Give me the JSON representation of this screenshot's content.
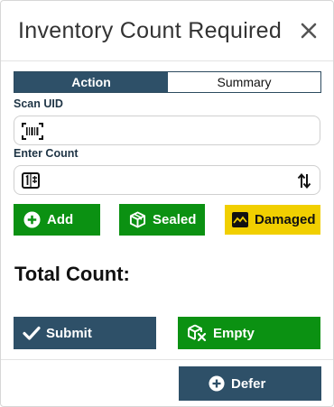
{
  "dialog": {
    "title": "Inventory Count Required"
  },
  "tabs": [
    {
      "label": "Action",
      "active": true
    },
    {
      "label": "Summary",
      "active": false
    }
  ],
  "scan_uid": {
    "label": "Scan UID",
    "value": ""
  },
  "enter_count": {
    "label": "Enter Count",
    "value": ""
  },
  "item_buttons": {
    "add": "Add",
    "sealed": "Sealed",
    "damaged": "Damaged"
  },
  "total": {
    "label": "Total Count:"
  },
  "footer_buttons": {
    "submit": "Submit",
    "empty": "Empty",
    "defer": "Defer"
  },
  "colors": {
    "primary": "#2e5068",
    "success": "#0b9112",
    "warning": "#f1cf00"
  }
}
